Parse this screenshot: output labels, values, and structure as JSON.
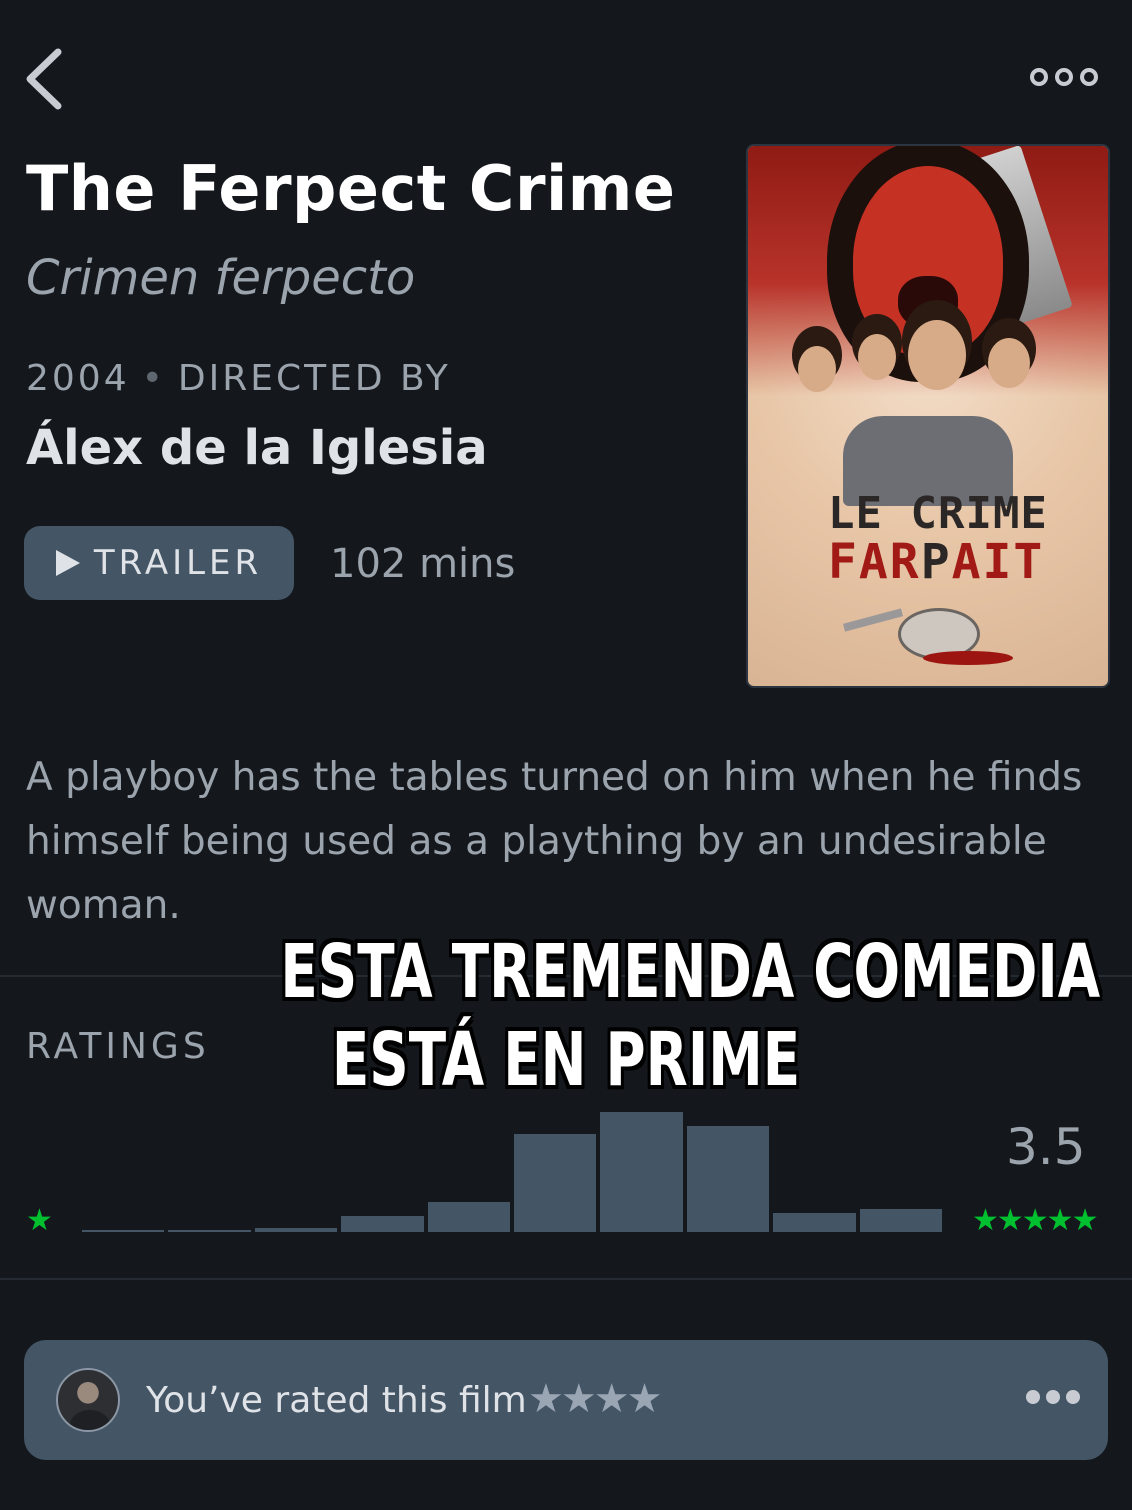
{
  "header": {
    "back_icon": "chevron-left-icon",
    "more_icon": "ellipsis-icon"
  },
  "film": {
    "title": "The Ferpect Crime",
    "original_title": "Crimen ferpecto",
    "year": "2004",
    "directed_by_label": "DIRECTED BY",
    "director": "Álex de la Iglesia",
    "trailer_label": "TRAILER",
    "runtime": "102 mins",
    "synopsis": "A playboy has the tables turned on him when he finds himself being used as a plaything by an undesirable woman."
  },
  "poster": {
    "line1": "LE CRIME",
    "line2_red_a": "FAR",
    "line2_dark": "P",
    "line2_red_b": "AIT"
  },
  "ratings": {
    "label": "RATINGS",
    "min_stars": "★",
    "max_stars": "★★★★★",
    "average": "3.5",
    "star_color": "#00c030",
    "histogram_relative_heights": [
      0.02,
      0.02,
      0.03,
      0.13,
      0.25,
      0.82,
      1.0,
      0.88,
      0.16,
      0.19
    ]
  },
  "overlay": {
    "line1": "ESTA TREMENDA COMEDIA",
    "line2": "ESTÁ EN PRIME"
  },
  "user_rating": {
    "text": "You’ve rated this film",
    "stars": "★★★★",
    "more_icon": "ellipsis-icon"
  }
}
